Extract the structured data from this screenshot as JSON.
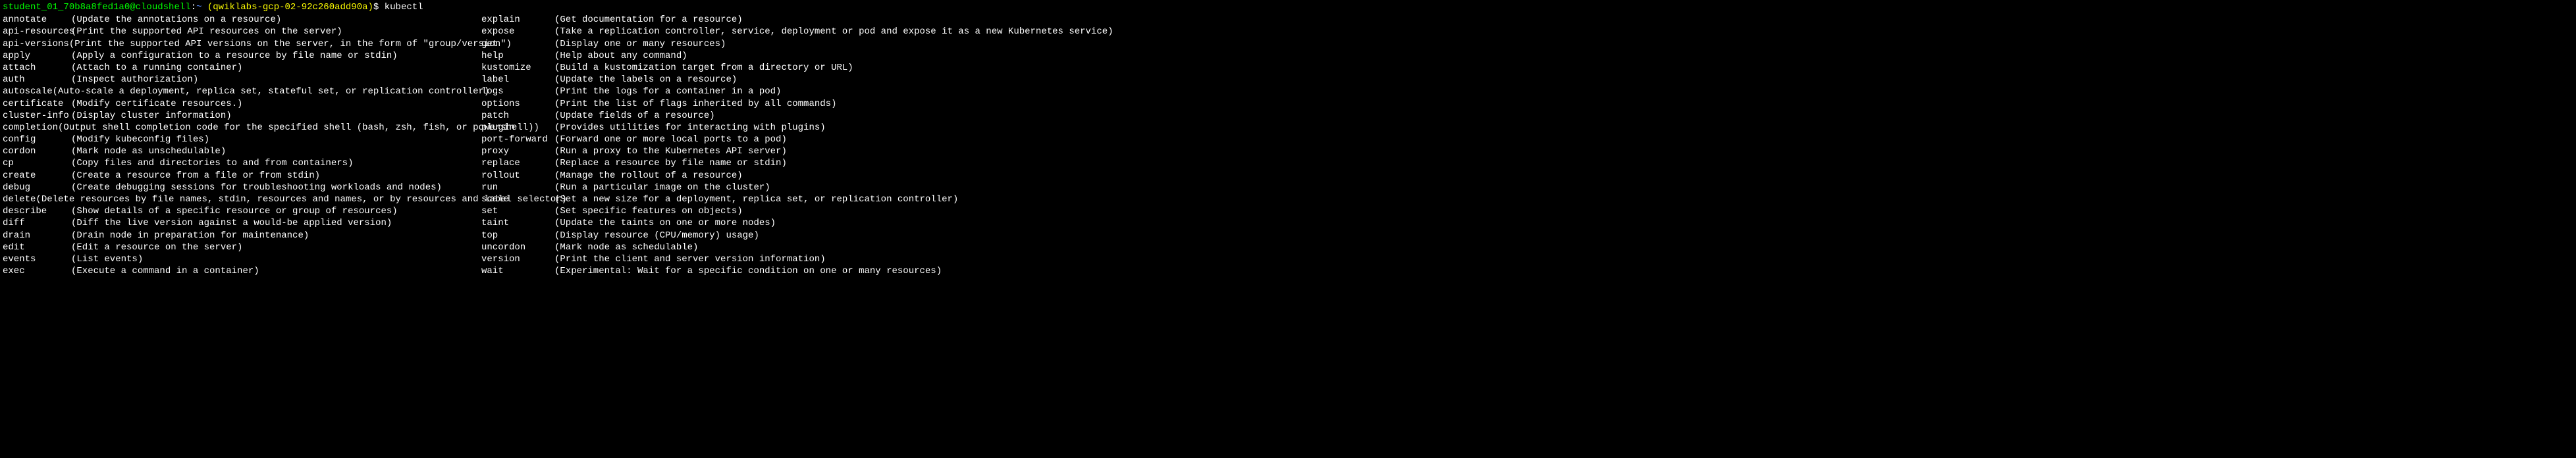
{
  "prompt": {
    "user": "student_01_70b8a8fed1a0@cloudshell",
    "colon": ":",
    "tilde": "~",
    "project": "(qwiklabs-gcp-02-92c260add90a)",
    "dollar": "$",
    "command": "kubectl"
  },
  "left": [
    {
      "cmd": "annotate",
      "desc": "(Update the annotations on a resource)"
    },
    {
      "cmd": "api-resources",
      "desc": "(Print the supported API resources on the server)"
    },
    {
      "cmd": "api-versions",
      "desc": "(Print the supported API versions on the server, in the form of \"group/version\")"
    },
    {
      "cmd": "apply",
      "desc": "(Apply a configuration to a resource by file name or stdin)"
    },
    {
      "cmd": "attach",
      "desc": "(Attach to a running container)"
    },
    {
      "cmd": "auth",
      "desc": "(Inspect authorization)"
    },
    {
      "cmd": "autoscale",
      "desc": "(Auto-scale a deployment, replica set, stateful set, or replication controller)"
    },
    {
      "cmd": "certificate",
      "desc": "(Modify certificate resources.)"
    },
    {
      "cmd": "cluster-info",
      "desc": "(Display cluster information)"
    },
    {
      "cmd": "completion",
      "desc": "(Output shell completion code for the specified shell (bash, zsh, fish, or powershell))"
    },
    {
      "cmd": "config",
      "desc": "(Modify kubeconfig files)"
    },
    {
      "cmd": "cordon",
      "desc": "(Mark node as unschedulable)"
    },
    {
      "cmd": "cp",
      "desc": "(Copy files and directories to and from containers)"
    },
    {
      "cmd": "create",
      "desc": "(Create a resource from a file or from stdin)"
    },
    {
      "cmd": "debug",
      "desc": "(Create debugging sessions for troubleshooting workloads and nodes)"
    },
    {
      "cmd": "delete",
      "desc": "(Delete resources by file names, stdin, resources and names, or by resources and label selector)"
    },
    {
      "cmd": "describe",
      "desc": "(Show details of a specific resource or group of resources)"
    },
    {
      "cmd": "diff",
      "desc": "(Diff the live version against a would-be applied version)"
    },
    {
      "cmd": "drain",
      "desc": "(Drain node in preparation for maintenance)"
    },
    {
      "cmd": "edit",
      "desc": "(Edit a resource on the server)"
    },
    {
      "cmd": "events",
      "desc": "(List events)"
    },
    {
      "cmd": "exec",
      "desc": "(Execute a command in a container)"
    }
  ],
  "right": [
    {
      "cmd": "explain",
      "desc": "(Get documentation for a resource)"
    },
    {
      "cmd": "expose",
      "desc": "(Take a replication controller, service, deployment or pod and expose it as a new Kubernetes service)"
    },
    {
      "cmd": "get",
      "desc": "(Display one or many resources)"
    },
    {
      "cmd": "help",
      "desc": "(Help about any command)"
    },
    {
      "cmd": "kustomize",
      "desc": "(Build a kustomization target from a directory or URL)"
    },
    {
      "cmd": "label",
      "desc": "(Update the labels on a resource)"
    },
    {
      "cmd": "logs",
      "desc": "(Print the logs for a container in a pod)"
    },
    {
      "cmd": "options",
      "desc": "(Print the list of flags inherited by all commands)"
    },
    {
      "cmd": "patch",
      "desc": "(Update fields of a resource)"
    },
    {
      "cmd": "plugin",
      "desc": "(Provides utilities for interacting with plugins)"
    },
    {
      "cmd": "port-forward",
      "desc": "(Forward one or more local ports to a pod)"
    },
    {
      "cmd": "proxy",
      "desc": "(Run a proxy to the Kubernetes API server)"
    },
    {
      "cmd": "replace",
      "desc": "(Replace a resource by file name or stdin)"
    },
    {
      "cmd": "rollout",
      "desc": "(Manage the rollout of a resource)"
    },
    {
      "cmd": "run",
      "desc": "(Run a particular image on the cluster)"
    },
    {
      "cmd": "scale",
      "desc": "(Set a new size for a deployment, replica set, or replication controller)"
    },
    {
      "cmd": "set",
      "desc": "(Set specific features on objects)"
    },
    {
      "cmd": "taint",
      "desc": "(Update the taints on one or more nodes)"
    },
    {
      "cmd": "top",
      "desc": "(Display resource (CPU/memory) usage)"
    },
    {
      "cmd": "uncordon",
      "desc": "(Mark node as schedulable)"
    },
    {
      "cmd": "version",
      "desc": "(Print the client and server version information)"
    },
    {
      "cmd": "wait",
      "desc": "(Experimental: Wait for a specific condition on one or many resources)"
    }
  ]
}
